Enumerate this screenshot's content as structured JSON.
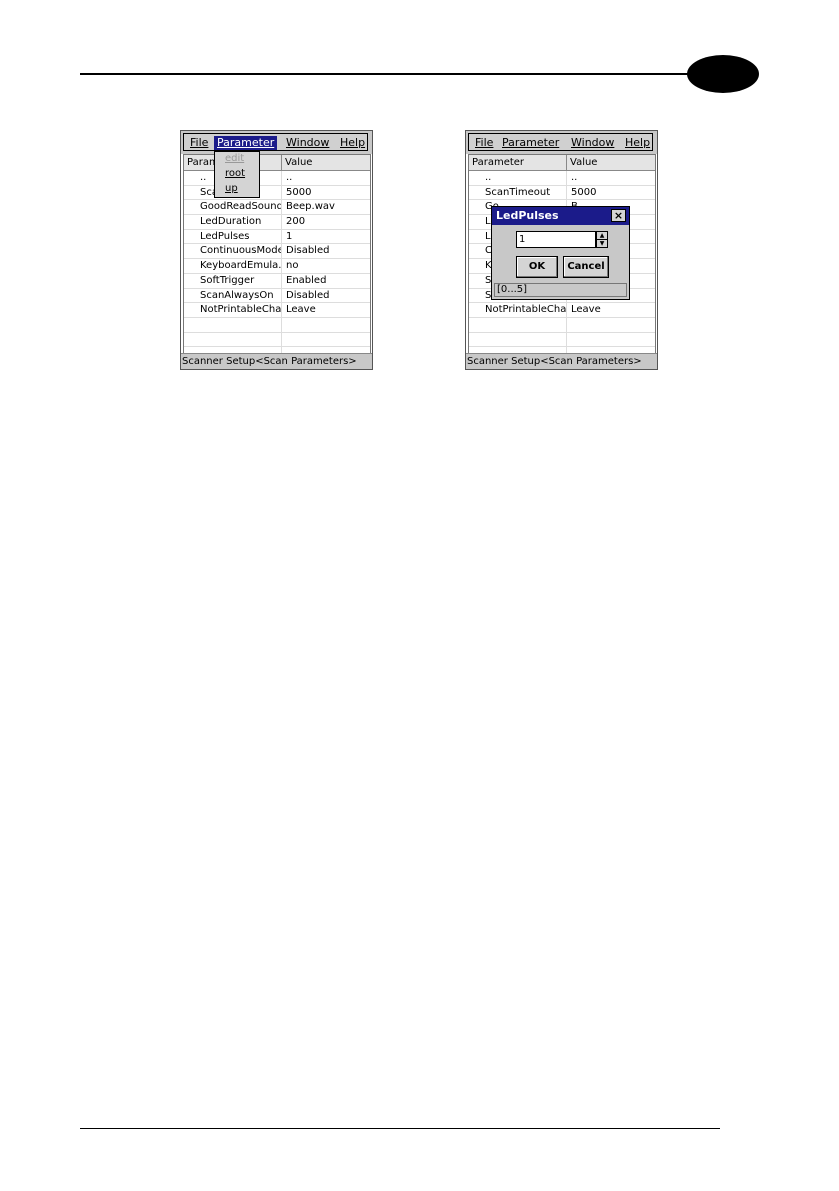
{
  "left_screen": {
    "menu": {
      "file": "File",
      "parameter": "Parameter",
      "window": "Window",
      "help": "Help"
    },
    "columns": {
      "parameter": "Param",
      "value": "Value"
    },
    "dropdown": {
      "edit": "edit",
      "root": "root",
      "up": "up"
    },
    "rows": [
      {
        "param": "..",
        "value": ".."
      },
      {
        "param": "Sca",
        "value": "5000"
      },
      {
        "param": "GoodReadSound",
        "value": "Beep.wav"
      },
      {
        "param": "LedDuration",
        "value": "200"
      },
      {
        "param": "LedPulses",
        "value": "1"
      },
      {
        "param": "ContinuousMode",
        "value": "Disabled"
      },
      {
        "param": "KeyboardEmula...",
        "value": "no"
      },
      {
        "param": "SoftTrigger",
        "value": "Enabled"
      },
      {
        "param": "ScanAlwaysOn",
        "value": "Disabled"
      },
      {
        "param": "NotPrintableChar",
        "value": "Leave"
      },
      {
        "param": "",
        "value": ""
      },
      {
        "param": "",
        "value": ""
      },
      {
        "param": "",
        "value": ""
      }
    ],
    "status": "Scanner Setup<Scan Parameters>"
  },
  "right_screen": {
    "menu": {
      "file": "File",
      "parameter": "Parameter",
      "window": "Window",
      "help": "Help"
    },
    "columns": {
      "parameter": "Parameter",
      "value": "Value"
    },
    "rows": [
      {
        "param": "..",
        "value": ".."
      },
      {
        "param": "ScanTimeout",
        "value": "5000"
      },
      {
        "param": "Go",
        "value": "B"
      },
      {
        "param": "Le",
        "value": ""
      },
      {
        "param": "Le",
        "value": ""
      },
      {
        "param": "Co",
        "value": ""
      },
      {
        "param": "Ke",
        "value": ""
      },
      {
        "param": "So",
        "value": ""
      },
      {
        "param": "Sc",
        "value": ""
      },
      {
        "param": "NotPrintableChar",
        "value": "Leave"
      },
      {
        "param": "",
        "value": ""
      },
      {
        "param": "",
        "value": ""
      },
      {
        "param": "",
        "value": ""
      }
    ],
    "dialog": {
      "title": "LedPulses",
      "close": "×",
      "value": "1",
      "ok": "OK",
      "cancel": "Cancel",
      "range": "[0...5]"
    },
    "status": "Scanner Setup<Scan Parameters>"
  },
  "colors": {
    "titlebar": "#1b1b8a",
    "chrome": "#c8c8c8"
  },
  "icons": {
    "close": "close-icon",
    "spin_up": "spin-up-arrow-icon",
    "spin_down": "spin-down-arrow-icon"
  }
}
